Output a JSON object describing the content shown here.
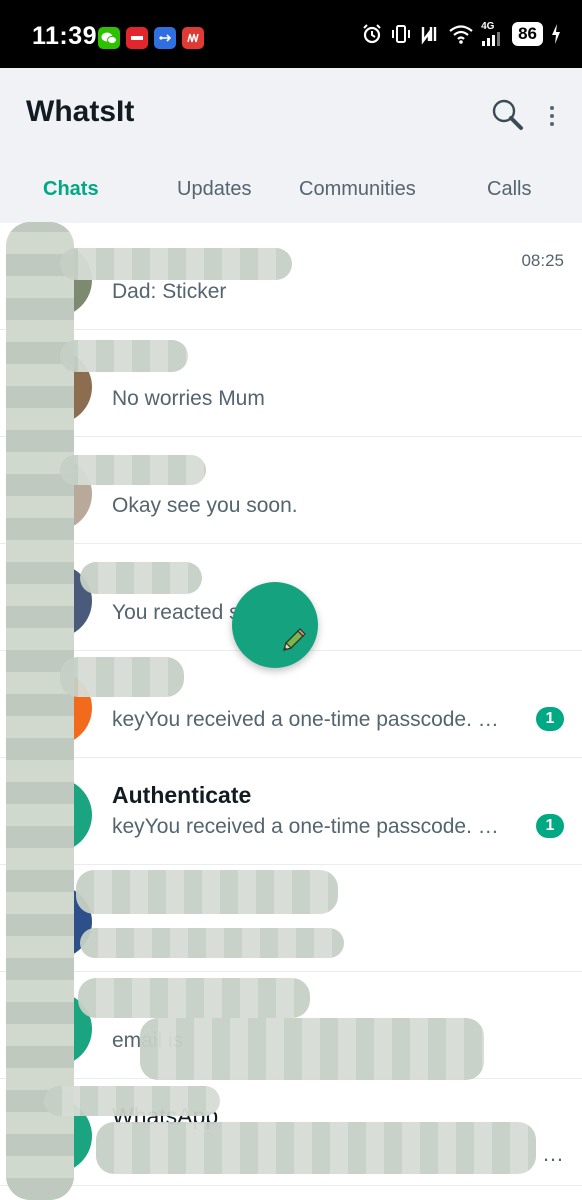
{
  "status_bar": {
    "time": "11:39",
    "notifications": [
      "wechat-icon",
      "news-icon",
      "usb-icon",
      "brand-icon"
    ],
    "network_label": "4G",
    "battery": "86"
  },
  "header": {
    "title": "WhatsIt",
    "search_icon": "search-icon",
    "menu_icon": "more-vertical-icon"
  },
  "tabs": [
    {
      "label": "Chats",
      "active": true
    },
    {
      "label": "Updates",
      "active": false
    },
    {
      "label": "Communities",
      "active": false
    },
    {
      "label": "Calls",
      "active": false
    }
  ],
  "chats": [
    {
      "name": "",
      "preview": "Dad: Sticker",
      "time": "08:25",
      "unread": ""
    },
    {
      "name": "",
      "preview": "No worries Mum",
      "time": "",
      "unread": ""
    },
    {
      "name": "",
      "preview": "Okay see you soon.",
      "time": "",
      "unread": ""
    },
    {
      "name": "",
      "preview": "You reacted  send\"",
      "time": "",
      "unread": ""
    },
    {
      "name": "",
      "preview": "keyYou received a one-time passcode. …",
      "time": "",
      "unread": "1"
    },
    {
      "name": "Authenticate",
      "preview": "keyYou received a one-time passcode. …",
      "time": "",
      "unread": "1"
    },
    {
      "name": "",
      "preview": "",
      "time": "",
      "unread": ""
    },
    {
      "name": "",
      "preview": "email is",
      "time": "",
      "unread": ""
    },
    {
      "name": "WhatsApp",
      "preview": "",
      "time": "",
      "unread": ""
    }
  ],
  "ellipsis_last": "…",
  "colors": {
    "accent": "#00a884",
    "header_bg": "#f0f2f5",
    "fab": "#15a37f"
  },
  "fab_icon": "pencil-icon"
}
